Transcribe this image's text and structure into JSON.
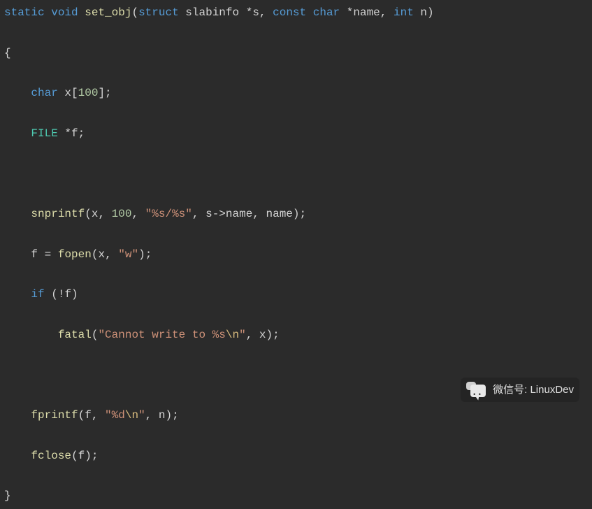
{
  "code": {
    "sig": {
      "static": "static",
      "void": "void",
      "fn": "set_obj",
      "struct": "struct",
      "slabinfo": "slabinfo",
      "s": "s",
      "const": "const",
      "char": "char",
      "name": "name",
      "int": "int",
      "n": "n"
    },
    "decl1": {
      "char": "char",
      "x": "x",
      "size": "100"
    },
    "decl2": {
      "FILE": "FILE",
      "f": "f"
    },
    "snp": {
      "fn": "snprintf",
      "x": "x",
      "size": "100",
      "fmt": "\"%s/%s\"",
      "s": "s",
      "arrow": "->",
      "name_field": "name",
      "name_arg": "name"
    },
    "fopen": {
      "f": "f",
      "fn": "fopen",
      "x": "x",
      "mode": "\"w\""
    },
    "iff": {
      "if": "if",
      "f": "f"
    },
    "fatal": {
      "fn": "fatal",
      "msg_a": "\"Cannot write to %s",
      "esc": "\\n",
      "msg_b": "\"",
      "x": "x"
    },
    "fprintf": {
      "fn": "fprintf",
      "f": "f",
      "fmt_a": "\"%d",
      "esc": "\\n",
      "fmt_b": "\"",
      "n": "n"
    },
    "fclose": {
      "fn": "fclose",
      "f": "f"
    }
  },
  "watermark": {
    "label": "微信号: LinuxDev"
  }
}
